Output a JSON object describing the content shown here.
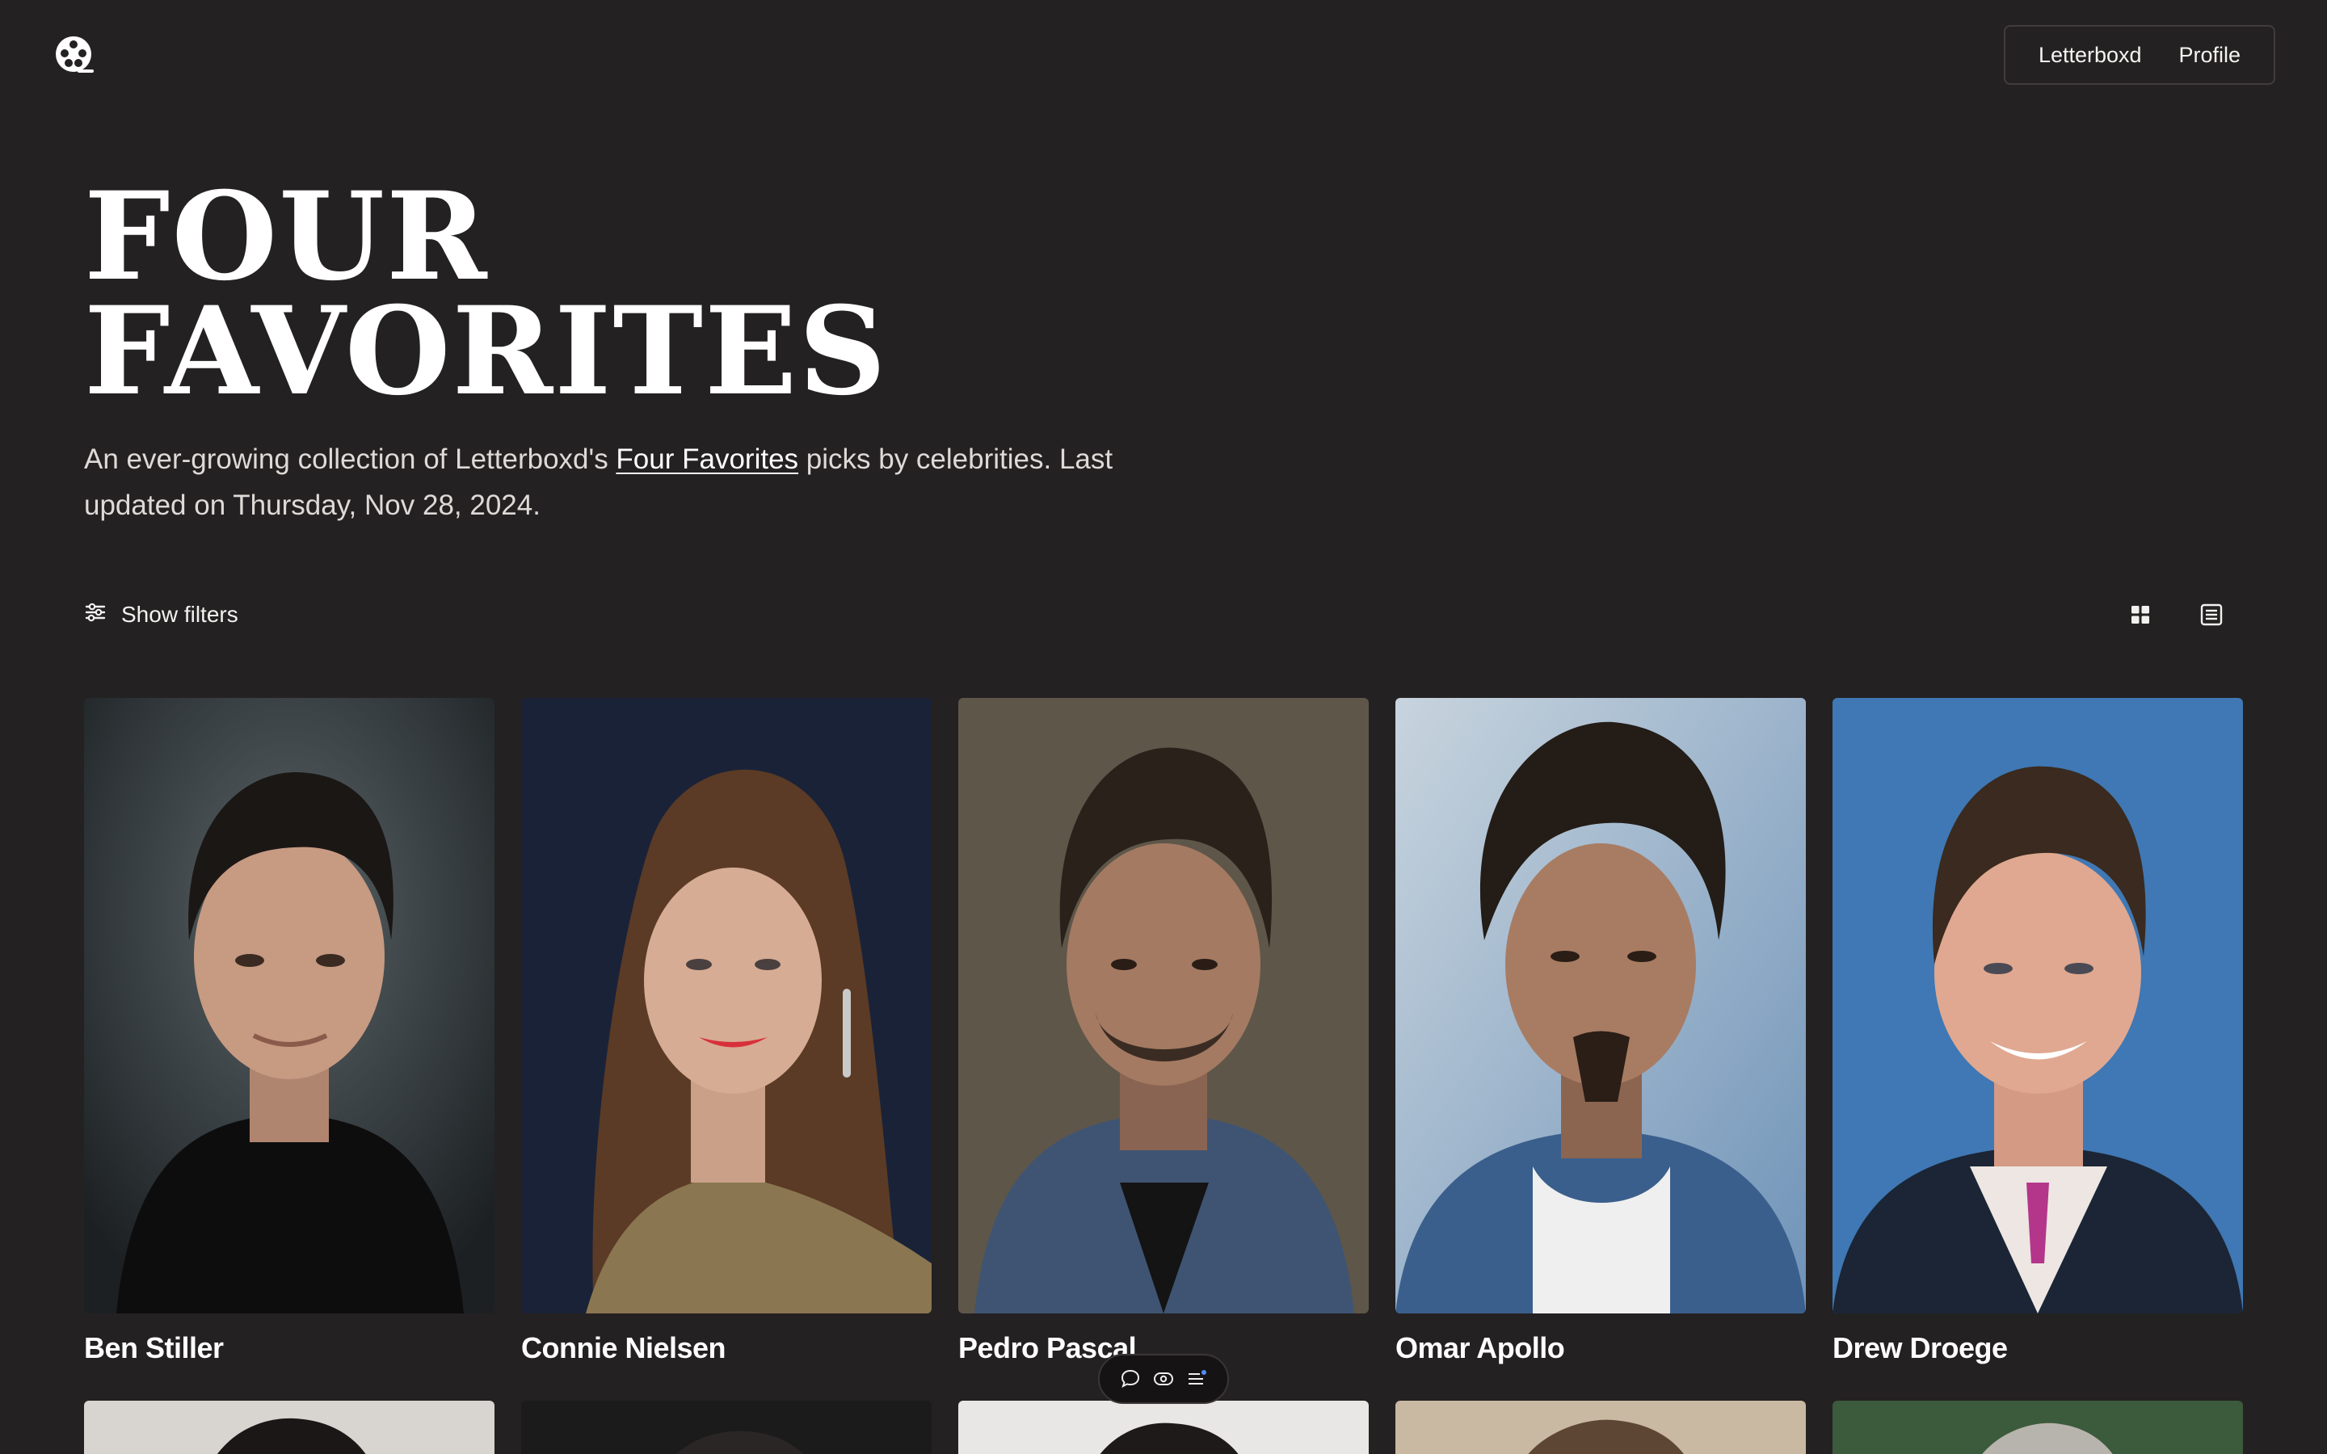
{
  "header": {
    "logo_icon": "film-reel-icon",
    "nav": [
      {
        "label": "Letterboxd"
      },
      {
        "label": "Profile"
      }
    ]
  },
  "hero": {
    "title_line1": "FOUR",
    "title_line2": "FAVORITES",
    "intro_before": "An ever-growing collection of Letterboxd's ",
    "intro_link": "Four Favorites",
    "intro_after": " picks by celebrities. Last updated on Thursday, Nov 28, 2024."
  },
  "toolbar": {
    "filters_label": "Show filters",
    "filters_icon": "sliders-icon",
    "view_grid_icon": "grid-view-icon",
    "view_list_icon": "list-view-icon"
  },
  "celebrities": [
    {
      "name": "Ben Stiller"
    },
    {
      "name": "Connie Nielsen"
    },
    {
      "name": "Pedro Pascal"
    },
    {
      "name": "Omar Apollo"
    },
    {
      "name": "Drew Droege"
    }
  ],
  "floating_toolbar": {
    "icons": [
      "comment-icon",
      "eye-icon",
      "menu-icon"
    ]
  },
  "colors": {
    "background": "#242122",
    "text": "#ffffff"
  }
}
